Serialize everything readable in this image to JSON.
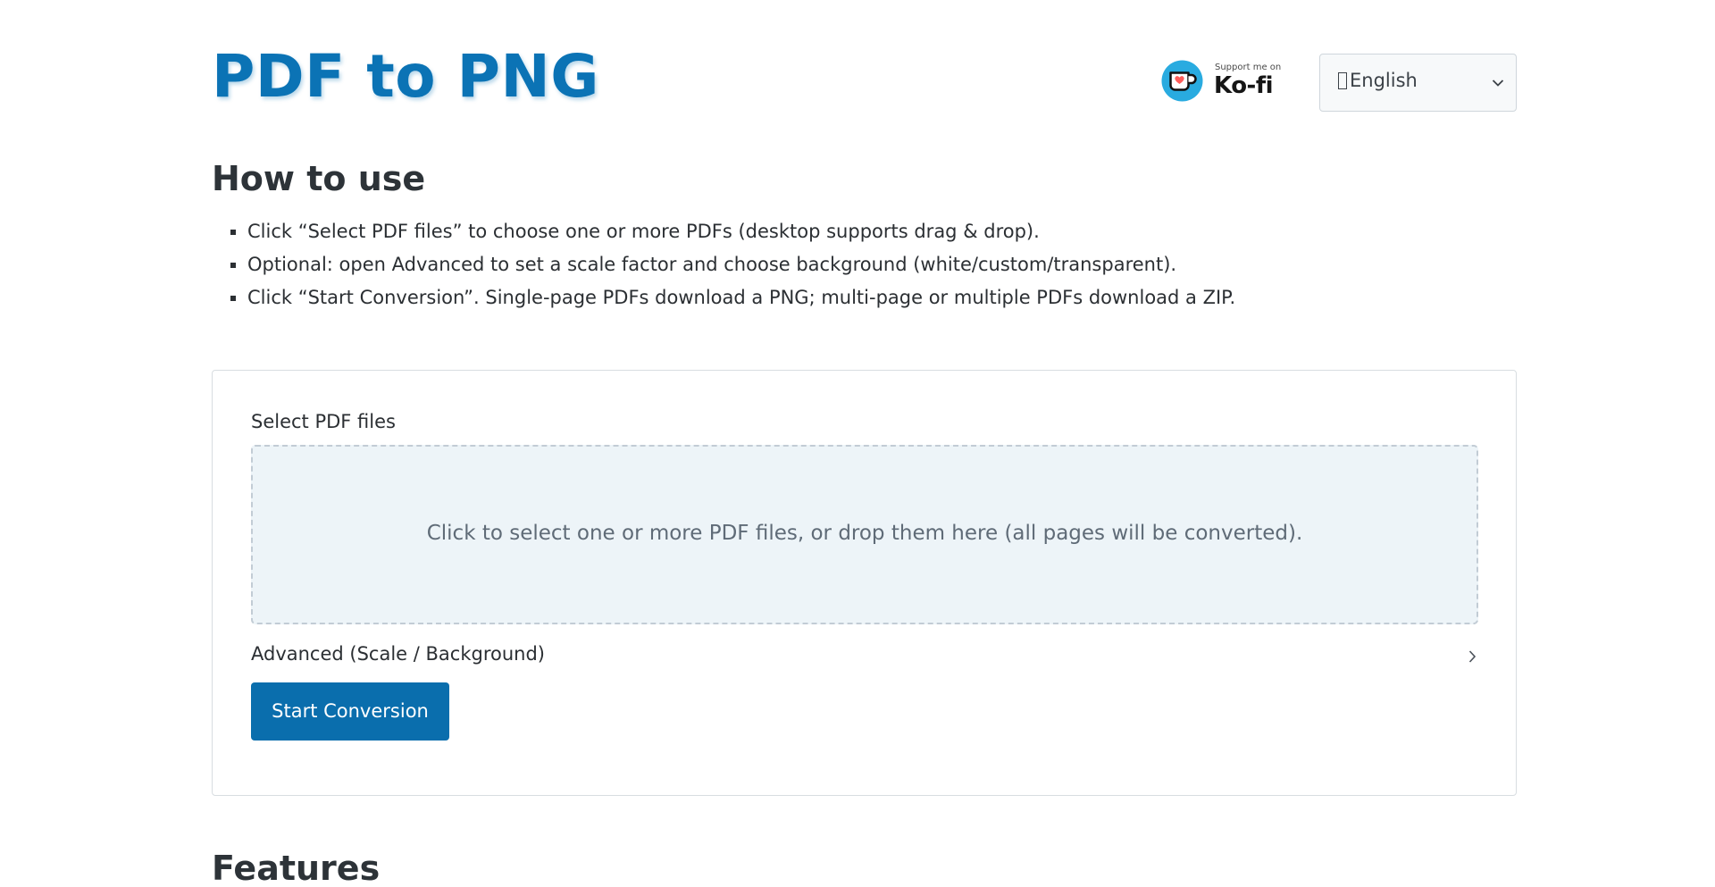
{
  "header": {
    "title": "PDF to PNG",
    "kofi": {
      "support_text": "Support me on",
      "name": "Ko-fi",
      "icon": "kofi-cup-icon",
      "accent_color": "#29abe0",
      "heart_color": "#ff5e5b"
    },
    "language": {
      "selected": "English",
      "icon": "chevron-down-icon"
    }
  },
  "how_to_use": {
    "title": "How to use",
    "steps": [
      "Click “Select PDF files” to choose one or more PDFs (desktop supports drag & drop).",
      "Optional: open Advanced to set a scale factor and choose background (white/custom/transparent).",
      "Click “Start Conversion”. Single-page PDFs download a PNG; multi-page or multiple PDFs download a ZIP."
    ]
  },
  "converter": {
    "select_label": "Select PDF files",
    "dropzone_text": "Click to select one or more PDF files, or drop them here (all pages will be converted).",
    "advanced_label": "Advanced (Scale / Background)",
    "advanced_icon": "chevron-right-icon",
    "start_button": "Start Conversion"
  },
  "features": {
    "title": "Features"
  },
  "colors": {
    "brand": "#0b73b5",
    "button": "#0a6ead",
    "dropzone_bg": "#edf4f8",
    "dropzone_border": "#c2ccd5"
  }
}
